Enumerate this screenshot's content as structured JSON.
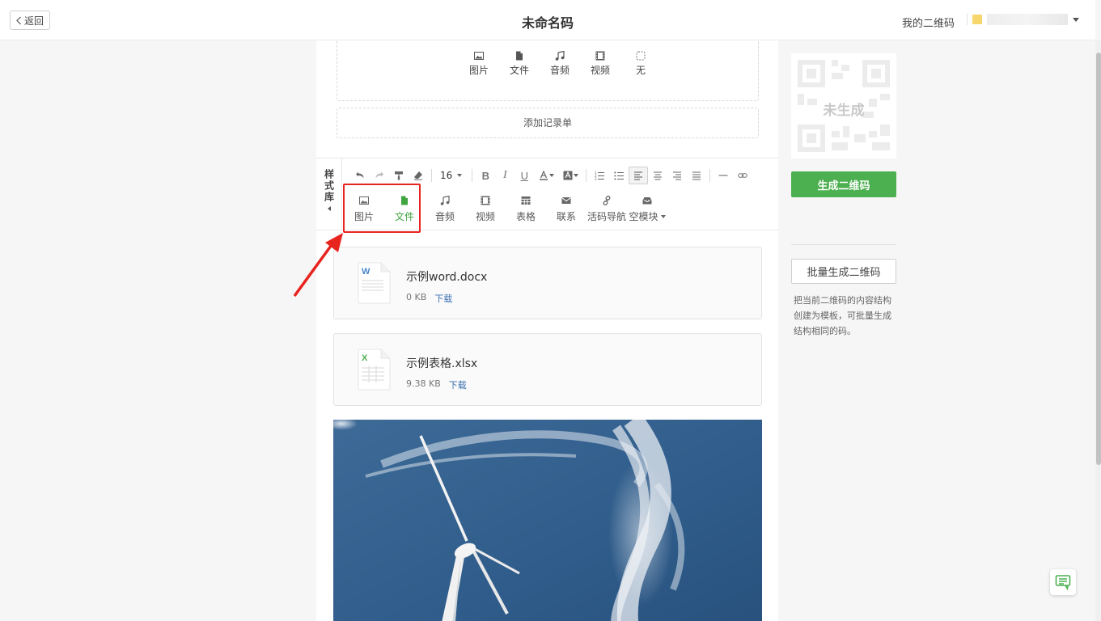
{
  "header": {
    "back_label": "返回",
    "title": "未命名码",
    "my_qr_label": "我的二维码"
  },
  "media_selector": {
    "options": [
      {
        "icon": "image-icon",
        "label": "图片"
      },
      {
        "icon": "file-icon",
        "label": "文件"
      },
      {
        "icon": "music-icon",
        "label": "音频"
      },
      {
        "icon": "video-icon",
        "label": "视频"
      },
      {
        "icon": "none-icon",
        "label": "无"
      }
    ],
    "add_record_label": "添加记录单"
  },
  "toolbar": {
    "style_library_label": "样式库",
    "font_size": "16",
    "insert_items": [
      {
        "icon": "image-icon",
        "label": "图片"
      },
      {
        "icon": "file-icon",
        "label": "文件",
        "active": true
      },
      {
        "icon": "music-icon",
        "label": "音频"
      },
      {
        "icon": "video-icon",
        "label": "视频"
      },
      {
        "icon": "table-icon",
        "label": "表格"
      },
      {
        "icon": "contact-icon",
        "label": "联系"
      },
      {
        "icon": "link-icon",
        "label": "活码导航"
      },
      {
        "icon": "block-icon",
        "label": "空模块"
      }
    ]
  },
  "files": [
    {
      "name": "示例word.docx",
      "size": "0 KB",
      "download_label": "下载",
      "type": "word",
      "type_letter": "W",
      "type_color": "#4a86c8"
    },
    {
      "name": "示例表格.xlsx",
      "size": "9.38 KB",
      "download_label": "下载",
      "type": "excel",
      "type_letter": "X",
      "type_color": "#4caf50"
    }
  ],
  "sidebar": {
    "qr_placeholder_label": "未生成",
    "generate_label": "生成二维码",
    "batch_label": "批量生成二维码",
    "batch_desc": "把当前二维码的内容结构创建为模板，可批量生成结构相同的码。"
  },
  "colors": {
    "accent_green": "#4caf50",
    "highlight_red": "#e8241f",
    "link_blue": "#3a6fb0"
  }
}
